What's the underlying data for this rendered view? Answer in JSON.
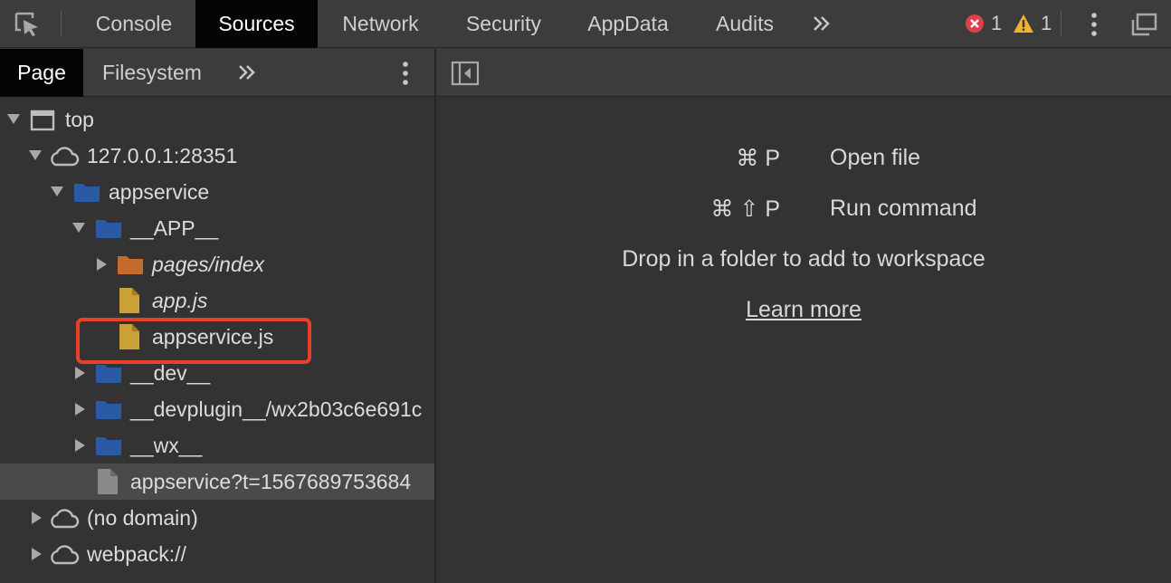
{
  "toolbar": {
    "tabs": [
      "Console",
      "Sources",
      "Network",
      "Security",
      "AppData",
      "Audits"
    ],
    "active_tab": "Sources",
    "error_count": "1",
    "warning_count": "1",
    "icons": {
      "inspect": "inspect-element-icon",
      "more_tabs": "double-chevron-right-icon",
      "error": "error-circle-icon",
      "warning": "warning-triangle-icon",
      "menu": "vertical-ellipsis-icon",
      "undock": "undock-window-icon"
    }
  },
  "navigator": {
    "tabs": [
      "Page",
      "Filesystem"
    ],
    "active_tab": "Page",
    "tree": [
      {
        "label": "top",
        "icon": "frame-icon",
        "expanded": true
      },
      {
        "label": "127.0.0.1:28351",
        "icon": "cloud-icon",
        "expanded": true
      },
      {
        "label": "appservice",
        "icon": "folder-icon",
        "expanded": true
      },
      {
        "label": "__APP__",
        "icon": "folder-icon",
        "expanded": true
      },
      {
        "label": "pages/index",
        "icon": "folder-icon",
        "expanded": false
      },
      {
        "label": "app.js",
        "icon": "file-icon"
      },
      {
        "label": "appservice.js",
        "icon": "file-icon",
        "highlighted": true
      },
      {
        "label": "__dev__",
        "icon": "folder-icon",
        "expanded": false
      },
      {
        "label": "__devplugin__/wx2b03c6e691c",
        "icon": "folder-icon",
        "expanded": false
      },
      {
        "label": "__wx__",
        "icon": "folder-icon",
        "expanded": false
      },
      {
        "label": "appservice?t=1567689753684",
        "icon": "file-icon",
        "selected": true
      },
      {
        "label": "(no domain)",
        "icon": "cloud-icon",
        "expanded": false
      },
      {
        "label": "webpack://",
        "icon": "cloud-icon",
        "expanded": false
      }
    ]
  },
  "editor": {
    "shortcuts": [
      {
        "keys": "⌘ P",
        "label": "Open file"
      },
      {
        "keys": "⌘ ⇧ P",
        "label": "Run command"
      }
    ],
    "drop_text": "Drop in a folder to add to workspace",
    "learn_more": "Learn more"
  },
  "colors": {
    "folder_blue": "#2a5aa6",
    "folder_orange": "#c46a2a",
    "file_js": "#c9a135",
    "file_generic": "#8a8a8a",
    "highlight": "#e8402a",
    "error": "#e0404a",
    "warning": "#f2b22f"
  }
}
